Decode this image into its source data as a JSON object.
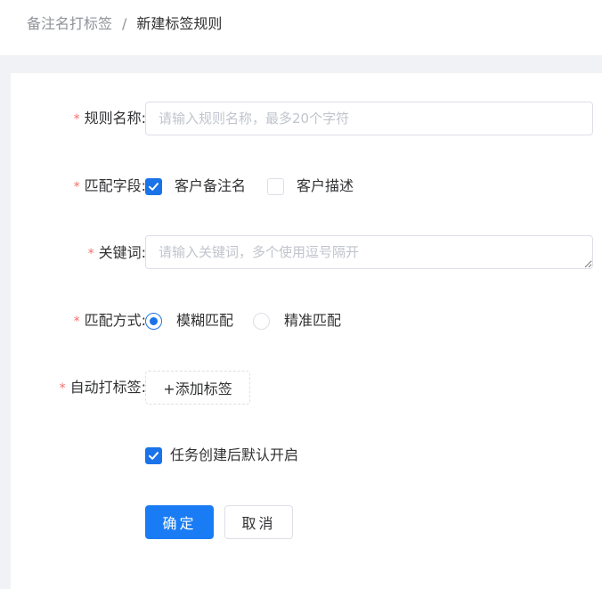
{
  "breadcrumb": {
    "parent": "备注名打标签",
    "separator": "/",
    "current": "新建标签规则"
  },
  "form": {
    "required_mark": "*",
    "rule_name": {
      "label": "规则名称:",
      "value": "",
      "placeholder": "请输入规则名称，最多20个字符"
    },
    "match_field": {
      "label": "匹配字段:",
      "options": [
        {
          "label": "客户备注名",
          "checked": true
        },
        {
          "label": "客户描述",
          "checked": false
        }
      ]
    },
    "keywords": {
      "label": "关键词:",
      "value": "",
      "placeholder": "请输入关键词，多个使用逗号隔开"
    },
    "match_mode": {
      "label": "匹配方式:",
      "options": [
        {
          "label": "模糊匹配",
          "selected": true
        },
        {
          "label": "精准匹配",
          "selected": false
        }
      ]
    },
    "auto_tag": {
      "label": "自动打标签:",
      "add_button": "+添加标签"
    },
    "default_enable": {
      "label": "任务创建后默认开启",
      "checked": true
    },
    "confirm_button": "确定",
    "cancel_button": "取消"
  },
  "colors": {
    "primary": "#1a7cf5",
    "required": "#f56c6c",
    "placeholder": "#c0c4cc",
    "border": "#dcdfe6"
  }
}
